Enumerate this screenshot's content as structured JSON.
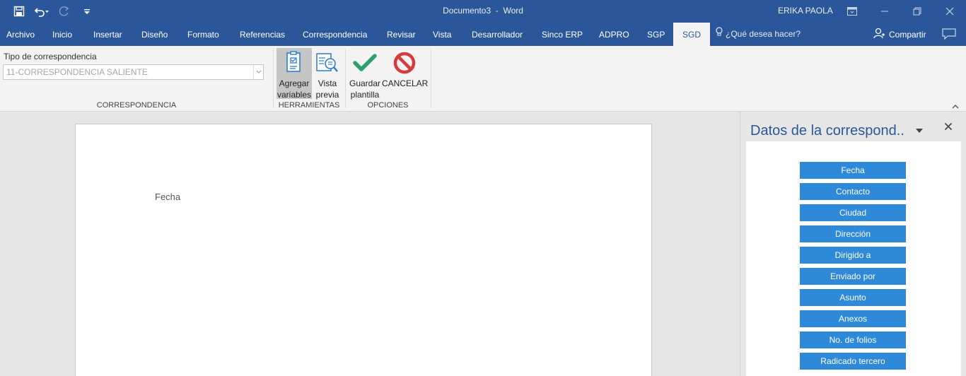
{
  "titlebar": {
    "document": "Documento3",
    "separator": "-",
    "app": "Word",
    "user": "ERIKA PAOLA"
  },
  "tabs": [
    "Archivo",
    "Inicio",
    "Insertar",
    "Diseño",
    "Formato",
    "Referencias",
    "Correspondencia",
    "Revisar",
    "Vista",
    "Desarrollador",
    "Sinco ERP",
    "ADPRO",
    "SGP",
    "SGD"
  ],
  "active_tab": "SGD",
  "tell_me": "¿Qué desea hacer?",
  "share": "Compartir",
  "ribbon": {
    "correspondence_label": "Tipo de correspondencia",
    "correspondence_value": "11-CORRESPONDENCIA SALIENTE",
    "group_correspondence": "CORRESPONDENCIA",
    "group_tools": "HERRAMIENTAS",
    "group_options": "OPCIONES",
    "add_vars_l1": "Agregar",
    "add_vars_l2": "variables",
    "preview_l1": "Vista",
    "preview_l2": "previa",
    "save_l1": "Guardar",
    "save_l2": "plantilla",
    "cancel": "CANCELAR"
  },
  "document": {
    "text": "Fecha"
  },
  "pane": {
    "title": "Datos de la correspond..",
    "buttons": [
      "Fecha",
      "Contacto",
      "Ciudad",
      "Dirección",
      "Dirigido a",
      "Enviado por",
      "Asunto",
      "Anexos",
      "No. de folios",
      "Radicado tercero"
    ]
  },
  "colors": {
    "brand": "#2b579a",
    "pane_button": "#2e8ad8",
    "ok_green": "#2e9e6b",
    "cancel_red": "#d83b3b"
  }
}
